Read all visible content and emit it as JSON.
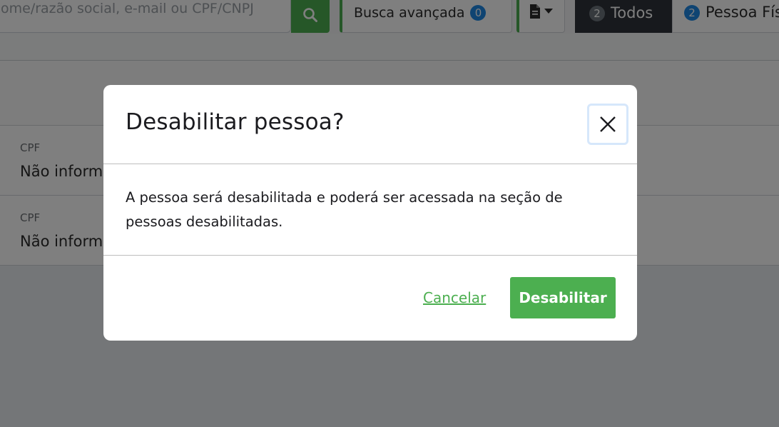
{
  "toolbar": {
    "search_placeholder": "ome/razão social, e-mail ou CPF/CNPJ",
    "search_button_icon": "search-icon",
    "advanced_search_label": "Busca avançada",
    "advanced_search_count": "0",
    "document_menu_icon": "document-icon",
    "tabs": [
      {
        "label": "Todos",
        "count": "2"
      },
      {
        "label": "Pessoa Fís",
        "count": "2"
      }
    ]
  },
  "rows": [
    {
      "label": "CPF",
      "value": "Não inform"
    },
    {
      "label": "CPF",
      "value": "Não inform"
    }
  ],
  "modal": {
    "title": "Desabilitar pessoa?",
    "close_icon": "close-icon",
    "message": "A pessoa será desabilitada e poderá ser acessada na seção de pessoas desabilitadas.",
    "cancel_label": "Cancelar",
    "confirm_label": "Desabilitar"
  },
  "colors": {
    "accent": "#4caf50",
    "badge": "#1e88e5",
    "active_tab": "#2f333a",
    "backdrop": "rgba(0,0,0,0.5)"
  }
}
